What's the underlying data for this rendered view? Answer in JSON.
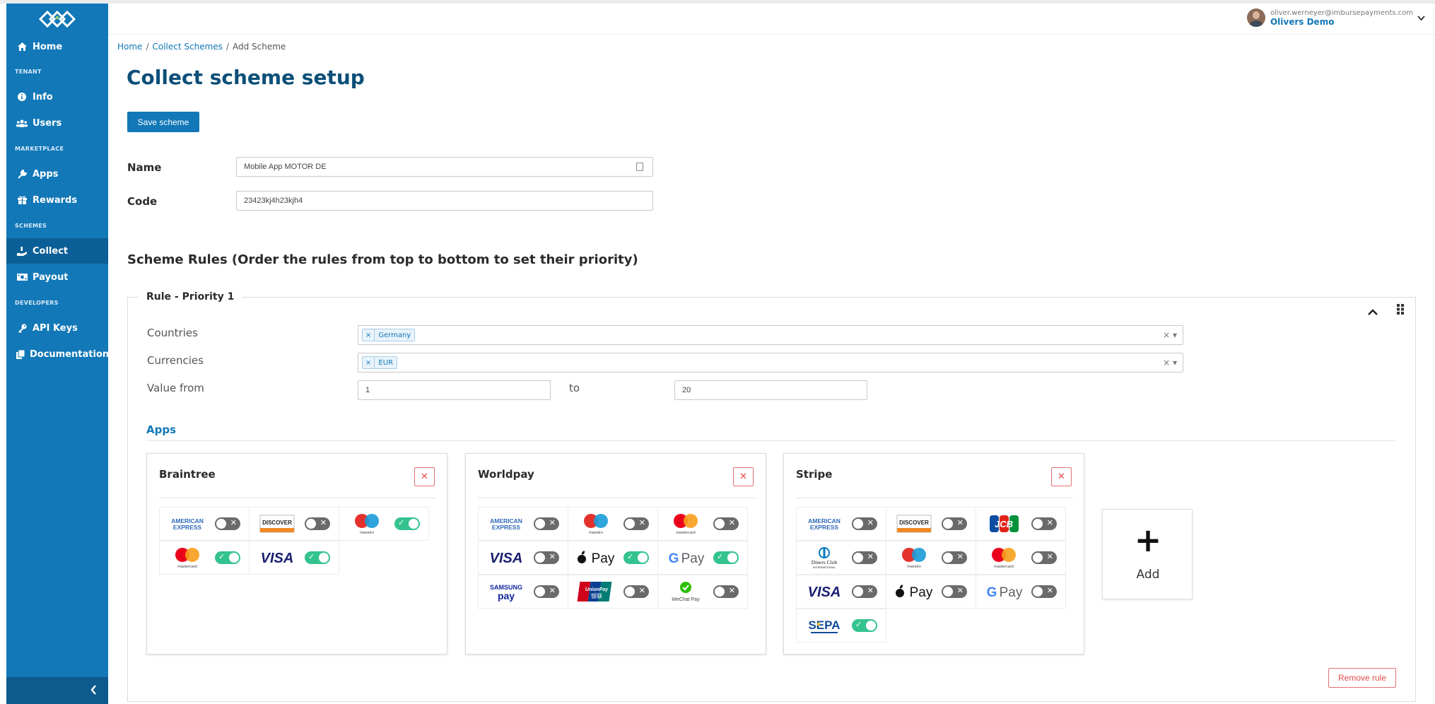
{
  "sidebar": {
    "items": [
      {
        "label": "Home",
        "icon": "home-icon"
      },
      {
        "label": "Info",
        "icon": "info-icon"
      },
      {
        "label": "Users",
        "icon": "users-icon"
      },
      {
        "label": "Apps",
        "icon": "wrench-icon"
      },
      {
        "label": "Rewards",
        "icon": "gift-icon"
      },
      {
        "label": "Collect",
        "icon": "hand-coin-icon",
        "active": true
      },
      {
        "label": "Payout",
        "icon": "money-icon"
      },
      {
        "label": "API Keys",
        "icon": "key-icon"
      },
      {
        "label": "Documentation",
        "icon": "copy-icon"
      }
    ],
    "sections": [
      "TENANT",
      "MARKETPLACE",
      "SCHEMES",
      "DEVELOPERS"
    ],
    "collapse_icon": "chevron-left-icon"
  },
  "header": {
    "email": "oliver.werneyer@imbursepayments.com",
    "org": "Olivers Demo",
    "dropdown_icon": "chevron-down-icon"
  },
  "breadcrumb": {
    "home": "Home",
    "collect": "Collect Schemes",
    "current": "Add Scheme",
    "separator": "/"
  },
  "page": {
    "title": "Collect scheme setup",
    "save_label": "Save scheme"
  },
  "form": {
    "name_label": "Name",
    "name_value": "Mobile App MOTOR DE",
    "code_label": "Code",
    "code_value": "23423kj4h23kjh4"
  },
  "rules": {
    "title": "Scheme Rules (Order the rules from top to bottom to set their priority)",
    "rule": {
      "legend": "Rule - Priority 1",
      "countries_label": "Countries",
      "countries_tag": "Germany",
      "currencies_label": "Currencies",
      "currencies_tag": "EUR",
      "value_from_label": "Value from",
      "value_from": "1",
      "to_label": "to",
      "value_to": "20",
      "apps_title": "Apps",
      "add_label": "Add",
      "remove_label": "Remove rule"
    }
  },
  "apps": [
    {
      "name": "Braintree",
      "methods": [
        {
          "brand": "amex",
          "on": false
        },
        {
          "brand": "discover",
          "on": false
        },
        {
          "brand": "maestro",
          "on": true
        },
        {
          "brand": "mastercard",
          "on": true
        },
        {
          "brand": "visa",
          "on": true
        }
      ]
    },
    {
      "name": "Worldpay",
      "methods": [
        {
          "brand": "amex",
          "on": false
        },
        {
          "brand": "maestro",
          "on": false
        },
        {
          "brand": "mastercard",
          "on": false
        },
        {
          "brand": "visa",
          "on": false
        },
        {
          "brand": "applepay",
          "on": true
        },
        {
          "brand": "googlepay",
          "on": true
        },
        {
          "brand": "samsungpay",
          "on": false
        },
        {
          "brand": "unionpay",
          "on": false
        },
        {
          "brand": "wechatpay",
          "on": false
        }
      ]
    },
    {
      "name": "Stripe",
      "methods": [
        {
          "brand": "amex",
          "on": false
        },
        {
          "brand": "discover",
          "on": false
        },
        {
          "brand": "jcb",
          "on": false
        },
        {
          "brand": "diners",
          "on": false
        },
        {
          "brand": "maestro",
          "on": false
        },
        {
          "brand": "mastercard",
          "on": false
        },
        {
          "brand": "visa",
          "on": false
        },
        {
          "brand": "applepay",
          "on": false
        },
        {
          "brand": "googlepay",
          "on": false
        },
        {
          "brand": "sepa",
          "on": true
        }
      ]
    }
  ],
  "brand_text": {
    "amex": [
      "AMERICAN",
      "EXPRESS"
    ],
    "discover": "DISCOVER",
    "maestro": "maestro",
    "mastercard": "mastercard",
    "visa": "VISA",
    "applepay": "Pay",
    "googlepay": [
      "G",
      "Pay"
    ],
    "samsungpay": [
      "SAMSUNG",
      "pay"
    ],
    "unionpay": [
      "UnionPay",
      "银联"
    ],
    "wechatpay": "WeChat Pay",
    "jcb": "JCB",
    "diners": [
      "Diners Club",
      "INTERNATIONAL"
    ],
    "sepa": "SEPA"
  },
  "colors": {
    "primary": "#1278b8",
    "sidebar": "#1278b8",
    "sidebar_active": "#0c5f96",
    "title": "#0c4f78",
    "toggle_on": "#34c38f",
    "toggle_off": "#6a6a6a",
    "danger": "#e04b4b"
  }
}
